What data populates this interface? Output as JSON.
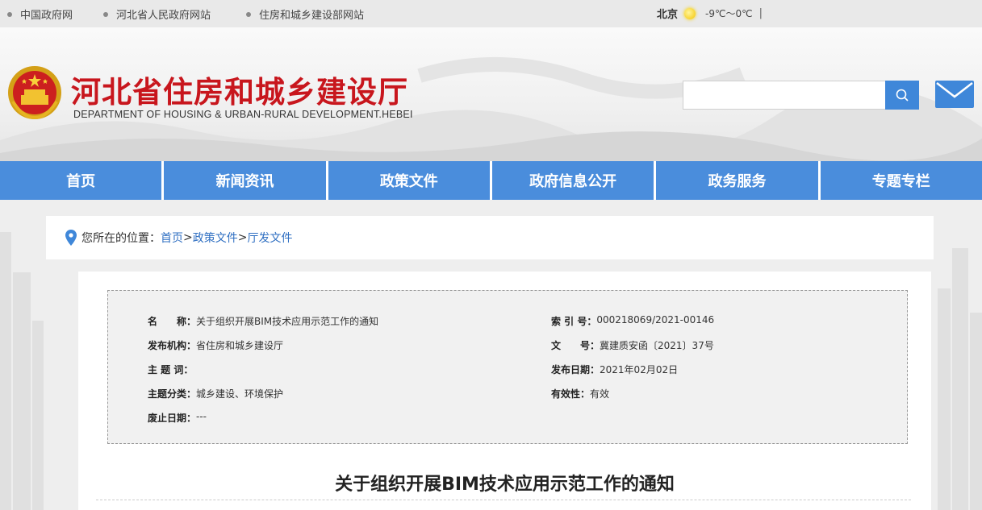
{
  "topbar": {
    "links": [
      "中国政府网",
      "河北省人民政府网站",
      "住房和城乡建设部网站"
    ],
    "weather": {
      "city": "北京",
      "temp": "-9℃～0℃",
      "sep": "|"
    }
  },
  "header": {
    "title_cn": "河北省住房和城乡建设厅",
    "title_en": "DEPARTMENT OF HOUSING & URBAN-RURAL DEVELOPMENT.HEBEI",
    "search_placeholder": ""
  },
  "nav": [
    "首页",
    "新闻资讯",
    "政策文件",
    "政府信息公开",
    "政务服务",
    "专题专栏"
  ],
  "breadcrumb": {
    "prefix": "您所在的位置：",
    "items": [
      "首页",
      "政策文件",
      "厅发文件"
    ],
    "sep": ">"
  },
  "meta": {
    "name_k": "名　　称：",
    "name_v": "关于组织开展BIM技术应用示范工作的通知",
    "index_k": "索 引 号：",
    "index_v": "000218069/2021-00146",
    "org_k": "发布机构：",
    "org_v": "省住房和城乡建设厅",
    "docno_k": "文　　号：",
    "docno_v": "冀建质安函〔2021〕37号",
    "keywords_k": "主 题 词：",
    "keywords_v": "",
    "date_k": "发布日期：",
    "date_v": "2021年02月02日",
    "category_k": "主题分类：",
    "category_v": "城乡建设、环境保护",
    "valid_k": "有效性：",
    "valid_v": "有效",
    "expire_k": "废止日期：",
    "expire_v": "---"
  },
  "document": {
    "title": "关于组织开展BIM技术应用示范工作的通知"
  },
  "colors": {
    "brand_red": "#c8161d",
    "nav_blue": "#4a8ddc",
    "link_blue": "#2f6fc2"
  }
}
